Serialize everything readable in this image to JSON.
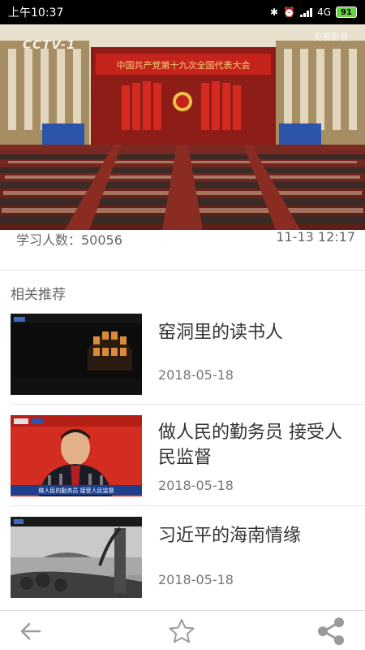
{
  "status_bar": {
    "time": "上午10:37",
    "network": "4G",
    "battery": "91"
  },
  "video": {
    "channel_logo": "CCTV-1",
    "banner_text": "中国共产党第十九次全国代表大会",
    "watermark": "央视影音"
  },
  "meta": {
    "learners": "学习人数：50056",
    "datetime": "11-13 12:17"
  },
  "related": {
    "heading": "相关推荐",
    "items": [
      {
        "title": "窑洞里的读书人",
        "date": "2018-05-18"
      },
      {
        "title": "做人民的勤务员 接受人民监督",
        "date": "2018-05-18",
        "caption": "做人民的勤务员 接受人民监督"
      },
      {
        "title": "习近平的海南情缘",
        "date": "2018-05-18"
      }
    ]
  },
  "bottom_bar": {
    "icons": [
      "back-arrow-icon",
      "star-icon",
      "share-icon"
    ]
  },
  "colors": {
    "stage_red": "#c4241c",
    "gold": "#f5d07a",
    "battery_green": "#6ad14b",
    "icon_gray": "#9a9a9a"
  }
}
